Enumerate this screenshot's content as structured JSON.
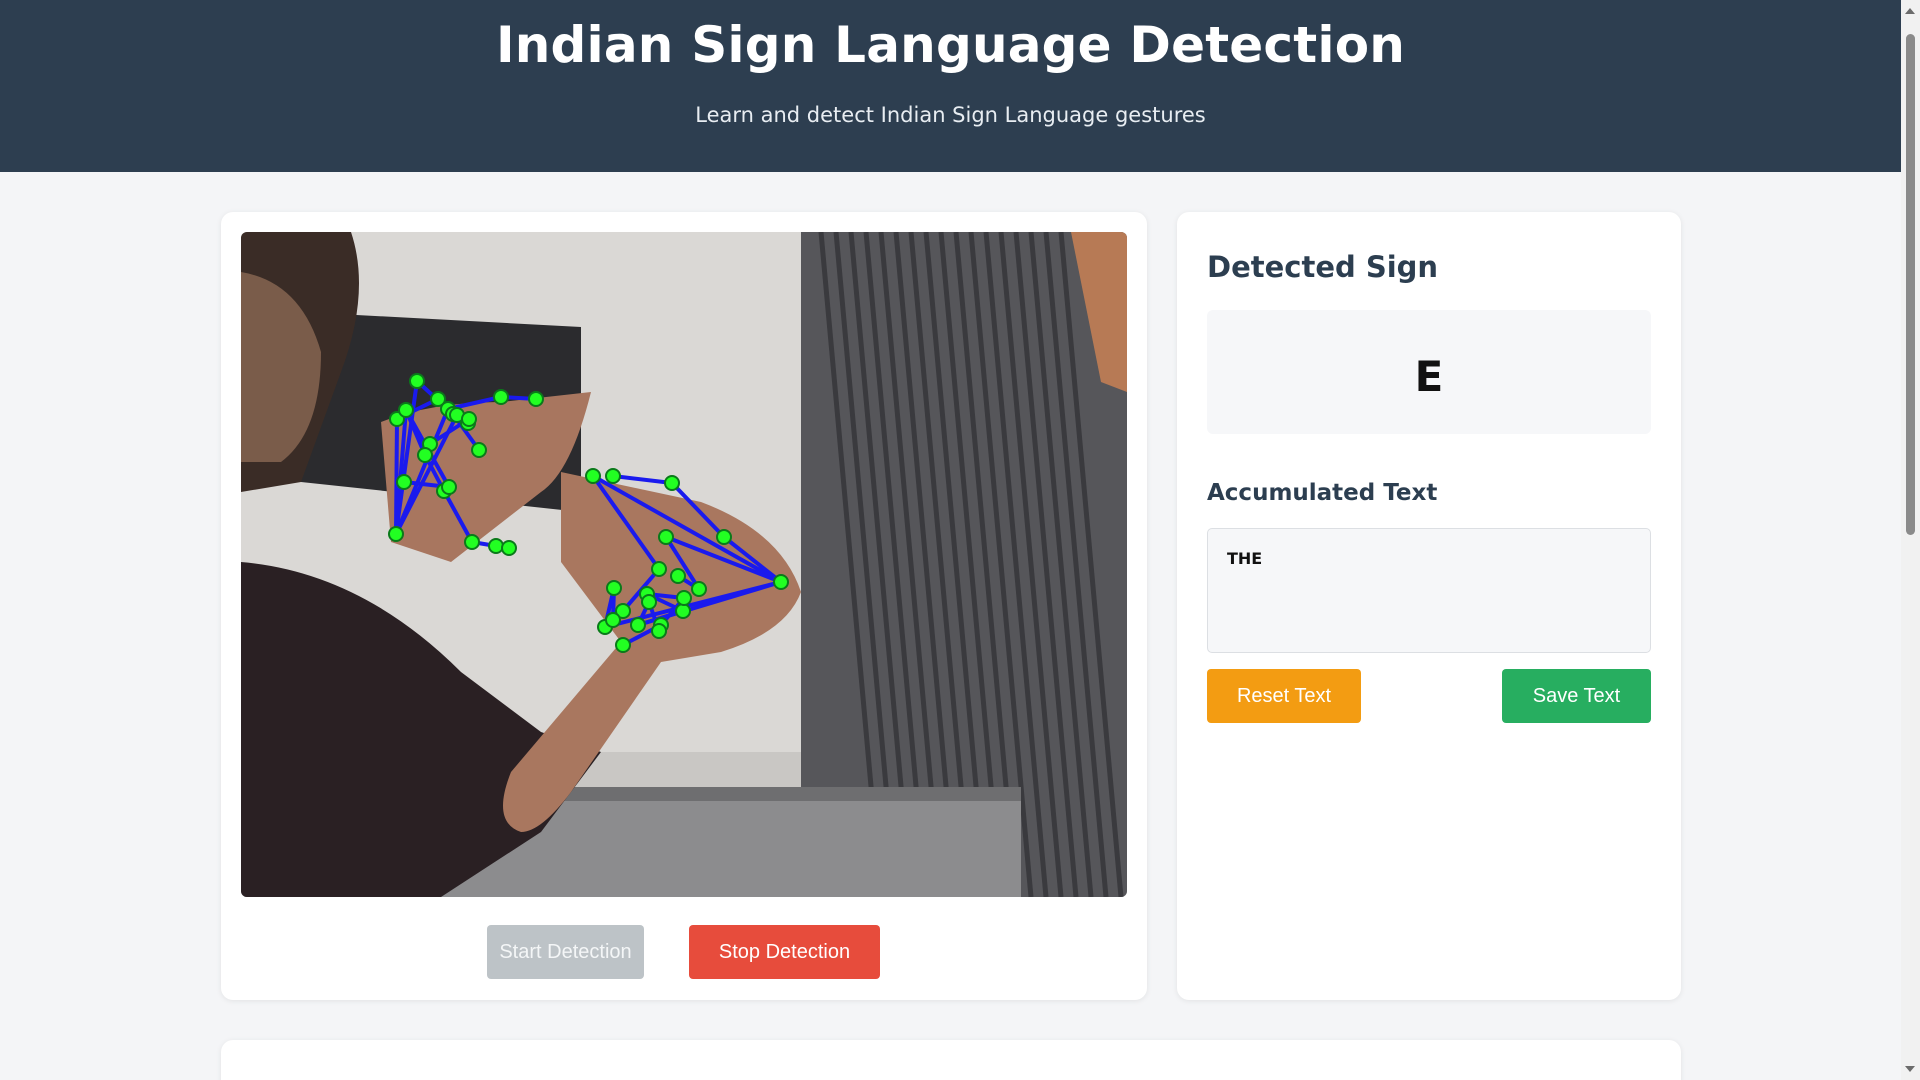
{
  "header": {
    "title": "Indian Sign Language Detection",
    "subtitle": "Learn and detect Indian Sign Language gestures"
  },
  "camera": {
    "start_label": "Start Detection",
    "stop_label": "Stop Detection"
  },
  "detected": {
    "title": "Detected Sign",
    "sign": "E"
  },
  "accumulated": {
    "title": "Accumulated Text",
    "text": "THE",
    "reset_label": "Reset Text",
    "save_label": "Save Text"
  },
  "colors": {
    "header_bg": "#2d3e50",
    "start_disabled": "#bdc3c7",
    "stop": "#e74c3c",
    "reset": "#f39c12",
    "save": "#27ae60",
    "landmark": "#22ff22",
    "connection": "#1a1aee"
  }
}
